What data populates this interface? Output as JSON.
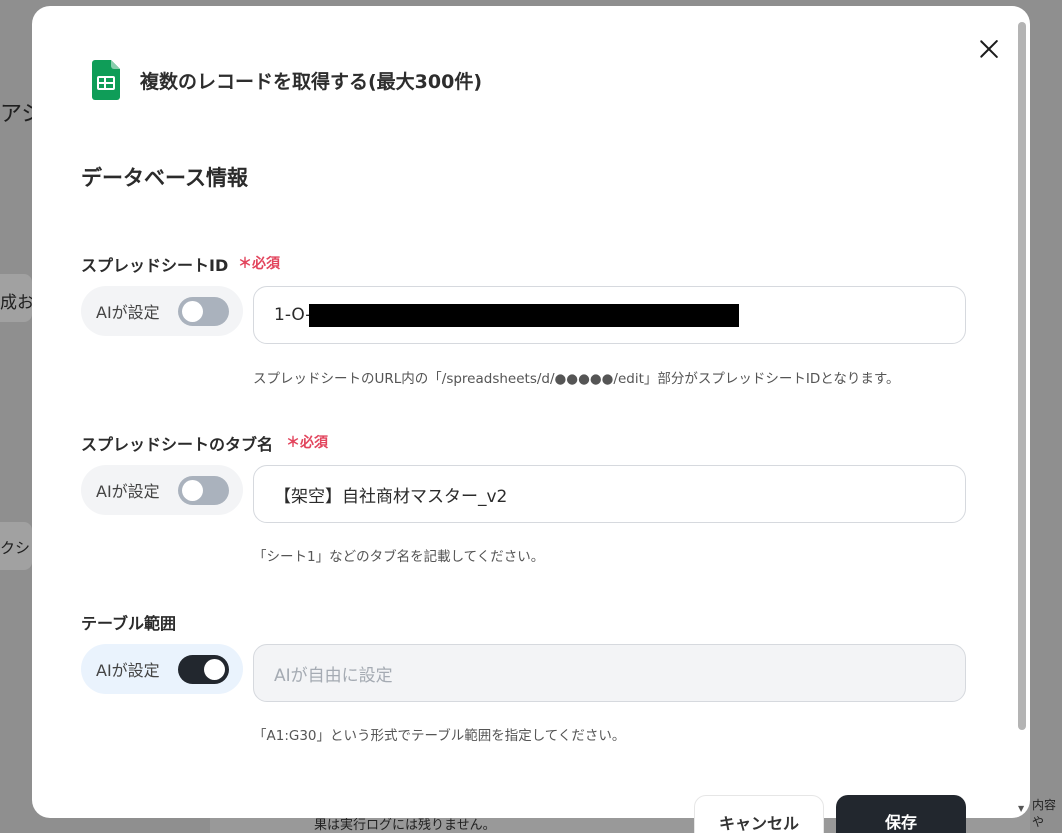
{
  "background": {
    "fragment_1": "アシ",
    "fragment_2": "成お",
    "fragment_3": "クショ",
    "bottom_text": "果は実行ログには残りません。",
    "right_text": "内容や"
  },
  "modal": {
    "title": "複数のレコードを取得する(最大300件)",
    "app_icon": "google-sheets-icon",
    "section_title": "データベース情報",
    "fields": {
      "spreadsheet_id": {
        "label": "スプレッドシートID",
        "required": "＊必須",
        "ai_label": "AIが設定",
        "ai_enabled": false,
        "value": "1-O-",
        "hint": "スプレッドシートのURL内の「/spreadsheets/d/●●●●●/edit」部分がスプレッドシートIDとなります。"
      },
      "tab_name": {
        "label": "スプレッドシートのタブ名",
        "required": "＊必須",
        "ai_label": "AIが設定",
        "ai_enabled": false,
        "value": "【架空】自社商材マスター_v2",
        "hint": "「シート1」などのタブ名を記載してください。"
      },
      "table_range": {
        "label": "テーブル範囲",
        "ai_label": "AIが設定",
        "ai_enabled": true,
        "placeholder": "AIが自由に設定",
        "hint": "「A1:G30」という形式でテーブル範囲を指定してください。"
      }
    },
    "buttons": {
      "cancel": "キャンセル",
      "save": "保存"
    }
  },
  "colors": {
    "required": "#e2445c",
    "toggle_on": "#22272e",
    "toggle_off": "#aab2bd",
    "sheets_green": "#0f9d58"
  }
}
